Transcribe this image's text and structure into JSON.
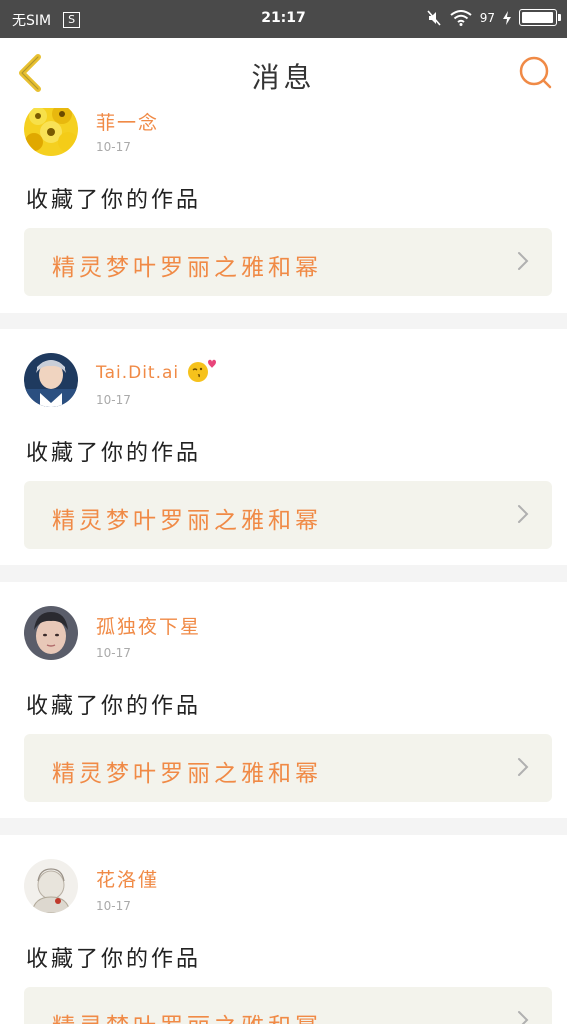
{
  "status_bar": {
    "carrier": "无SIM",
    "sim_label": "S",
    "time": "21:17",
    "battery_percent": "97",
    "battery_level": 0.97
  },
  "header": {
    "title": "消息"
  },
  "messages": [
    {
      "username": "菲一念",
      "date": "10-17",
      "action": "收藏了你的作品",
      "work_title": "精灵梦叶罗丽之雅和幂"
    },
    {
      "username": "Tai.Dit.ai",
      "date": "10-17",
      "action": "收藏了你的作品",
      "work_title": "精灵梦叶罗丽之雅和幂"
    },
    {
      "username": "孤独夜下星",
      "date": "10-17",
      "action": "收藏了你的作品",
      "work_title": "精灵梦叶罗丽之雅和幂"
    },
    {
      "username": "花洛僅",
      "date": "10-17",
      "action": "收藏了你的作品",
      "work_title": "精灵梦叶罗丽之雅和幂"
    }
  ],
  "colors": {
    "accent": "#f08a46",
    "back_arrow": "#e8c030",
    "status_bar": "#4a4a4a",
    "card_link_bg": "#f3f3ec"
  },
  "icons": {
    "back": "back-arrow-icon",
    "search": "search-icon",
    "chevron": "chevron-right-icon",
    "emoji": "kiss-emoji-icon"
  }
}
